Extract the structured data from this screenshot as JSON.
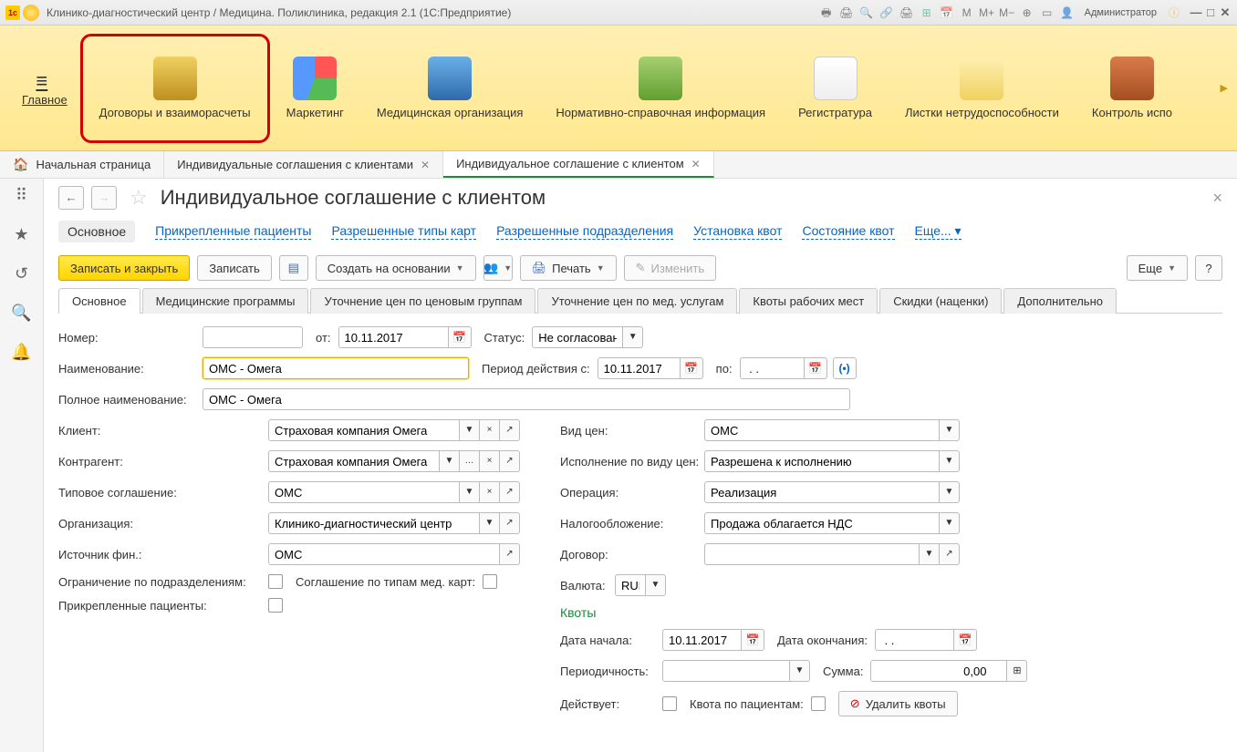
{
  "title": "Клинико-диагностический центр / Медицина. Поликлиника, редакция 2.1  (1С:Предприятие)",
  "user": "Администратор",
  "mainnav": {
    "main": "Главное",
    "contracts": "Договоры и взаиморасчеты",
    "marketing": "Маркетинг",
    "medorg": "Медицинская организация",
    "nsi": "Нормативно-справочная информация",
    "reg": "Регистратура",
    "sick": "Листки нетрудоспособности",
    "control": "Контроль испо"
  },
  "tabs": {
    "home": "Начальная страница",
    "t1": "Индивидуальные соглашения с клиентами",
    "t2": "Индивидуальное соглашение с клиентом"
  },
  "page": {
    "title": "Индивидуальное соглашение с клиентом",
    "sections": {
      "main": "Основное",
      "patients": "Прикрепленные пациенты",
      "cardtypes": "Разрешенные типы карт",
      "depts": "Разрешенные подразделения",
      "quotaSet": "Установка квот",
      "quotaState": "Состояние квот",
      "more": "Еще... ▾"
    },
    "toolbar": {
      "writeClose": "Записать и закрыть",
      "write": "Записать",
      "createBased": "Создать на основании",
      "print": "Печать",
      "edit": "Изменить",
      "more": "Еще",
      "help": "?"
    },
    "innerTabs": {
      "main": "Основное",
      "medprog": "Медицинские программы",
      "priceGroups": "Уточнение цен по ценовым группам",
      "priceServices": "Уточнение цен по мед. услугам",
      "quotas": "Квоты рабочих мест",
      "discounts": "Скидки (наценки)",
      "additional": "Дополнительно"
    },
    "form": {
      "numberLabel": "Номер:",
      "fromLabel": "от:",
      "fromDate": "10.11.2017",
      "statusLabel": "Статус:",
      "status": "Не согласован",
      "nameLabel": "Наименование:",
      "name": "ОМС - Омега",
      "periodLabel": "Период действия с:",
      "periodFrom": "10.11.2017",
      "periodToLabel": "по:",
      "periodTo": " . .",
      "fullNameLabel": "Полное наименование:",
      "fullName": "ОМС - Омега",
      "clientLabel": "Клиент:",
      "client": "Страховая компания Омега",
      "contragentLabel": "Контрагент:",
      "contragent": "Страховая компания Омега",
      "typeAgreeLabel": "Типовое соглашение:",
      "typeAgree": "ОМС",
      "orgLabel": "Организация:",
      "org": "Клинико-диагностический центр",
      "finSourceLabel": "Источник фин.:",
      "finSource": "ОМС",
      "deptLimitLabel": "Ограничение по подразделениям:",
      "cardAgreeLabel": "Соглашение по типам мед. карт:",
      "attachedLabel": "Прикрепленные пациенты:",
      "priceTypeLabel": "Вид цен:",
      "priceType": "ОМС",
      "execLabel": "Исполнение по виду цен:",
      "exec": "Разрешена к исполнению",
      "operationLabel": "Операция:",
      "operation": "Реализация",
      "taxLabel": "Налогообложение:",
      "tax": "Продажа облагается НДС",
      "dogLabel": "Договор:",
      "currencyLabel": "Валюта:",
      "currency": "RUB",
      "quotasTitle": "Квоты",
      "quotaStartLabel": "Дата начала:",
      "quotaStart": "10.11.2017",
      "quotaEndLabel": "Дата окончания:",
      "quotaEnd": " . .",
      "periodicityLabel": "Периодичность:",
      "sumLabel": "Сумма:",
      "sum": "0,00",
      "activeLabel": "Действует:",
      "patientQuotaLabel": "Квота по пациентам:",
      "deleteQuotas": "Удалить квоты"
    }
  }
}
